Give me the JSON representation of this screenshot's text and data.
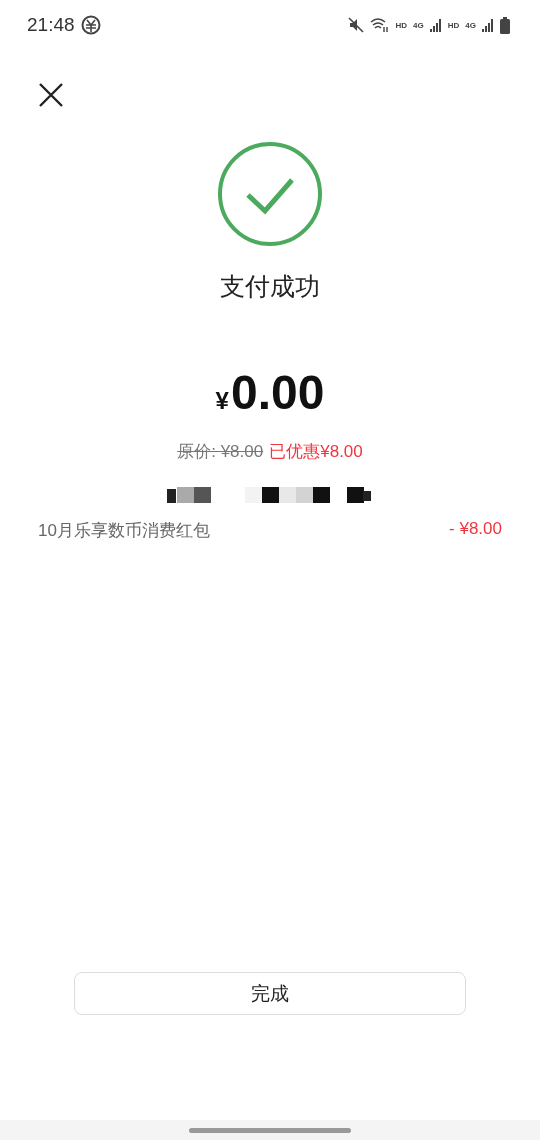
{
  "status_bar": {
    "time": "21:48",
    "network_labels": [
      "HD",
      "4G",
      "HD",
      "4G"
    ]
  },
  "result": {
    "succeeded": true,
    "title": "支付成功"
  },
  "amount": {
    "currency": "¥",
    "value": "0.00"
  },
  "original_price": "原价: ¥8.00",
  "discount_total": "已优惠¥8.00",
  "discounts": [
    {
      "name": "10月乐享数币消费红包",
      "amount": "- ¥8.00"
    }
  ],
  "done_button": "完成"
}
